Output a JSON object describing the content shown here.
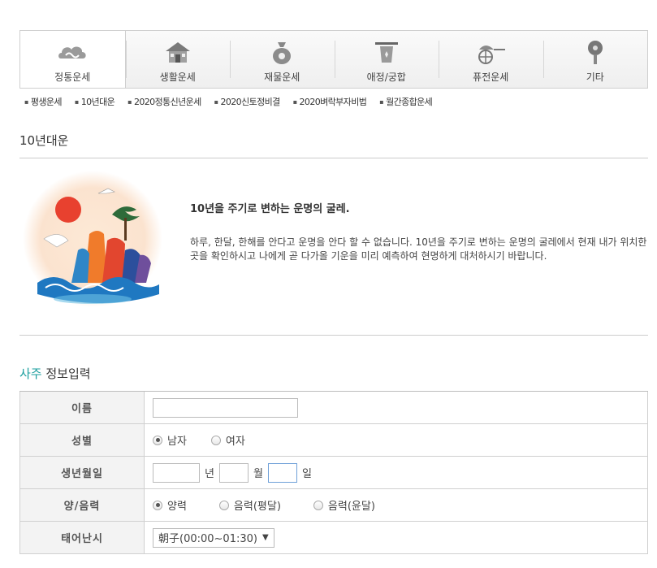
{
  "tabs": [
    {
      "label": "정통운세",
      "icon": "cloud-icon"
    },
    {
      "label": "생활운세",
      "icon": "house-icon"
    },
    {
      "label": "재물운세",
      "icon": "money-bag-icon"
    },
    {
      "label": "애정/궁합",
      "icon": "lantern-icon"
    },
    {
      "label": "퓨전운세",
      "icon": "cart-icon"
    },
    {
      "label": "기타",
      "icon": "fan-icon"
    }
  ],
  "submenu": [
    "평생운세",
    "10년대운",
    "2020정통신년운세",
    "2020신토정비결",
    "2020벼락부자비법",
    "월간종합운세"
  ],
  "section_title": "10년대운",
  "intro": {
    "headline": "10년을 주기로 변하는 운명의 굴레.",
    "body": "하루, 한달, 한해를 안다고 운명을 안다 할 수 없습니다. 10년을 주기로 변하는 운명의 굴레에서 현재 내가 위치한 곳을 확인하시고 나에게 곧 다가올 기운을 미리 예측하여 현명하게 대처하시기 바랍니다."
  },
  "form": {
    "title_accent": "사주",
    "title_rest": " 정보입력",
    "name_label": "이름",
    "name_value": "",
    "gender_label": "성별",
    "gender_male": "남자",
    "gender_female": "여자",
    "birth_label": "생년월일",
    "year_unit": "년",
    "month_unit": "월",
    "day_unit": "일",
    "calendar_label": "양/음력",
    "calendar_solar": "양력",
    "calendar_lunar_normal": "음력(평달)",
    "calendar_lunar_leap": "음력(윤달)",
    "birth_time_label": "태어난시",
    "birth_time_value": "朝子(00:00~01:30)",
    "dropdown_arrow": "▼"
  },
  "colors": {
    "accent": "#1a9e9e"
  }
}
